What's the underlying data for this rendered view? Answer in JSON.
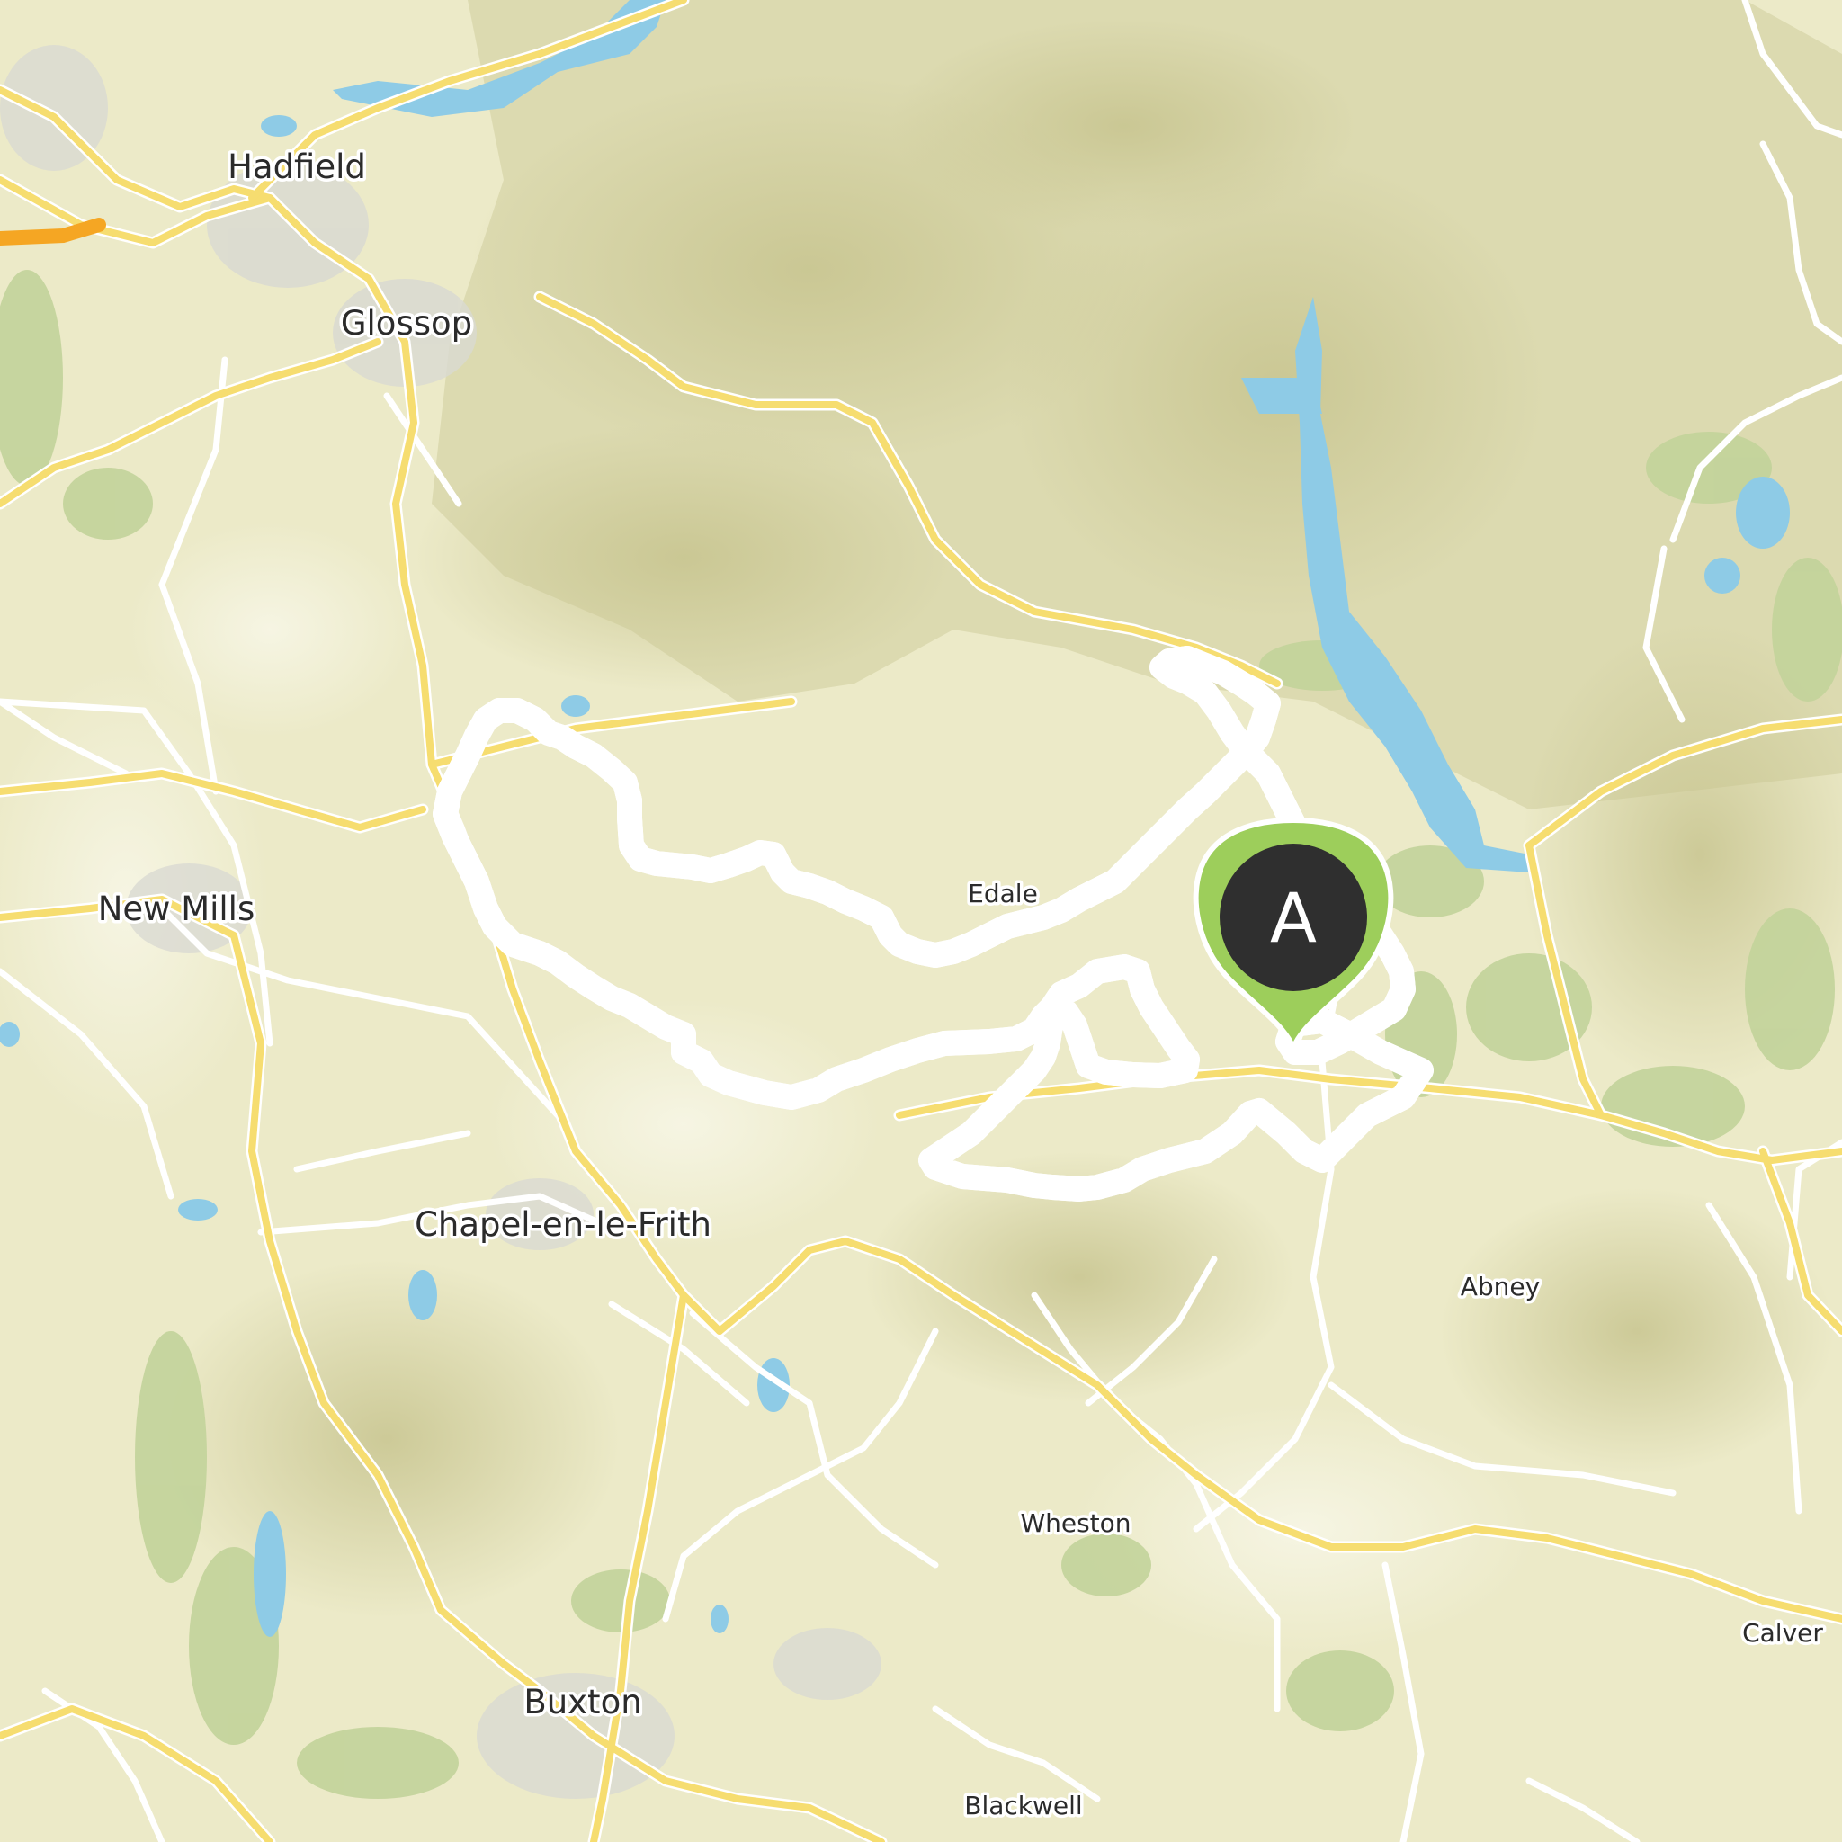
{
  "map": {
    "places": [
      {
        "name": "Hadfield",
        "kind": "town"
      },
      {
        "name": "Glossop",
        "kind": "town"
      },
      {
        "name": "New Mills",
        "kind": "town"
      },
      {
        "name": "Chapel-en-le-Frith",
        "kind": "town"
      },
      {
        "name": "Buxton",
        "kind": "town"
      },
      {
        "name": "Edale",
        "kind": "village"
      },
      {
        "name": "Abney",
        "kind": "village"
      },
      {
        "name": "Wheston",
        "kind": "village"
      },
      {
        "name": "Calver",
        "kind": "village"
      },
      {
        "name": "Blackwell",
        "kind": "village"
      }
    ],
    "route": {
      "color": "#1270c5",
      "outline": "#ffffff"
    },
    "start_marker": {
      "label": "A",
      "pin_color": "#8cc63f",
      "head_color": "#2f2f2f"
    },
    "colors": {
      "land": "#eceac8",
      "moorland": "#d4d3a2",
      "woodland": "#c2d39a",
      "water": "#8ecbe6",
      "major_road": "#f6dd70",
      "minor_road": "#ffffff",
      "motorway": "#f5a623"
    }
  }
}
